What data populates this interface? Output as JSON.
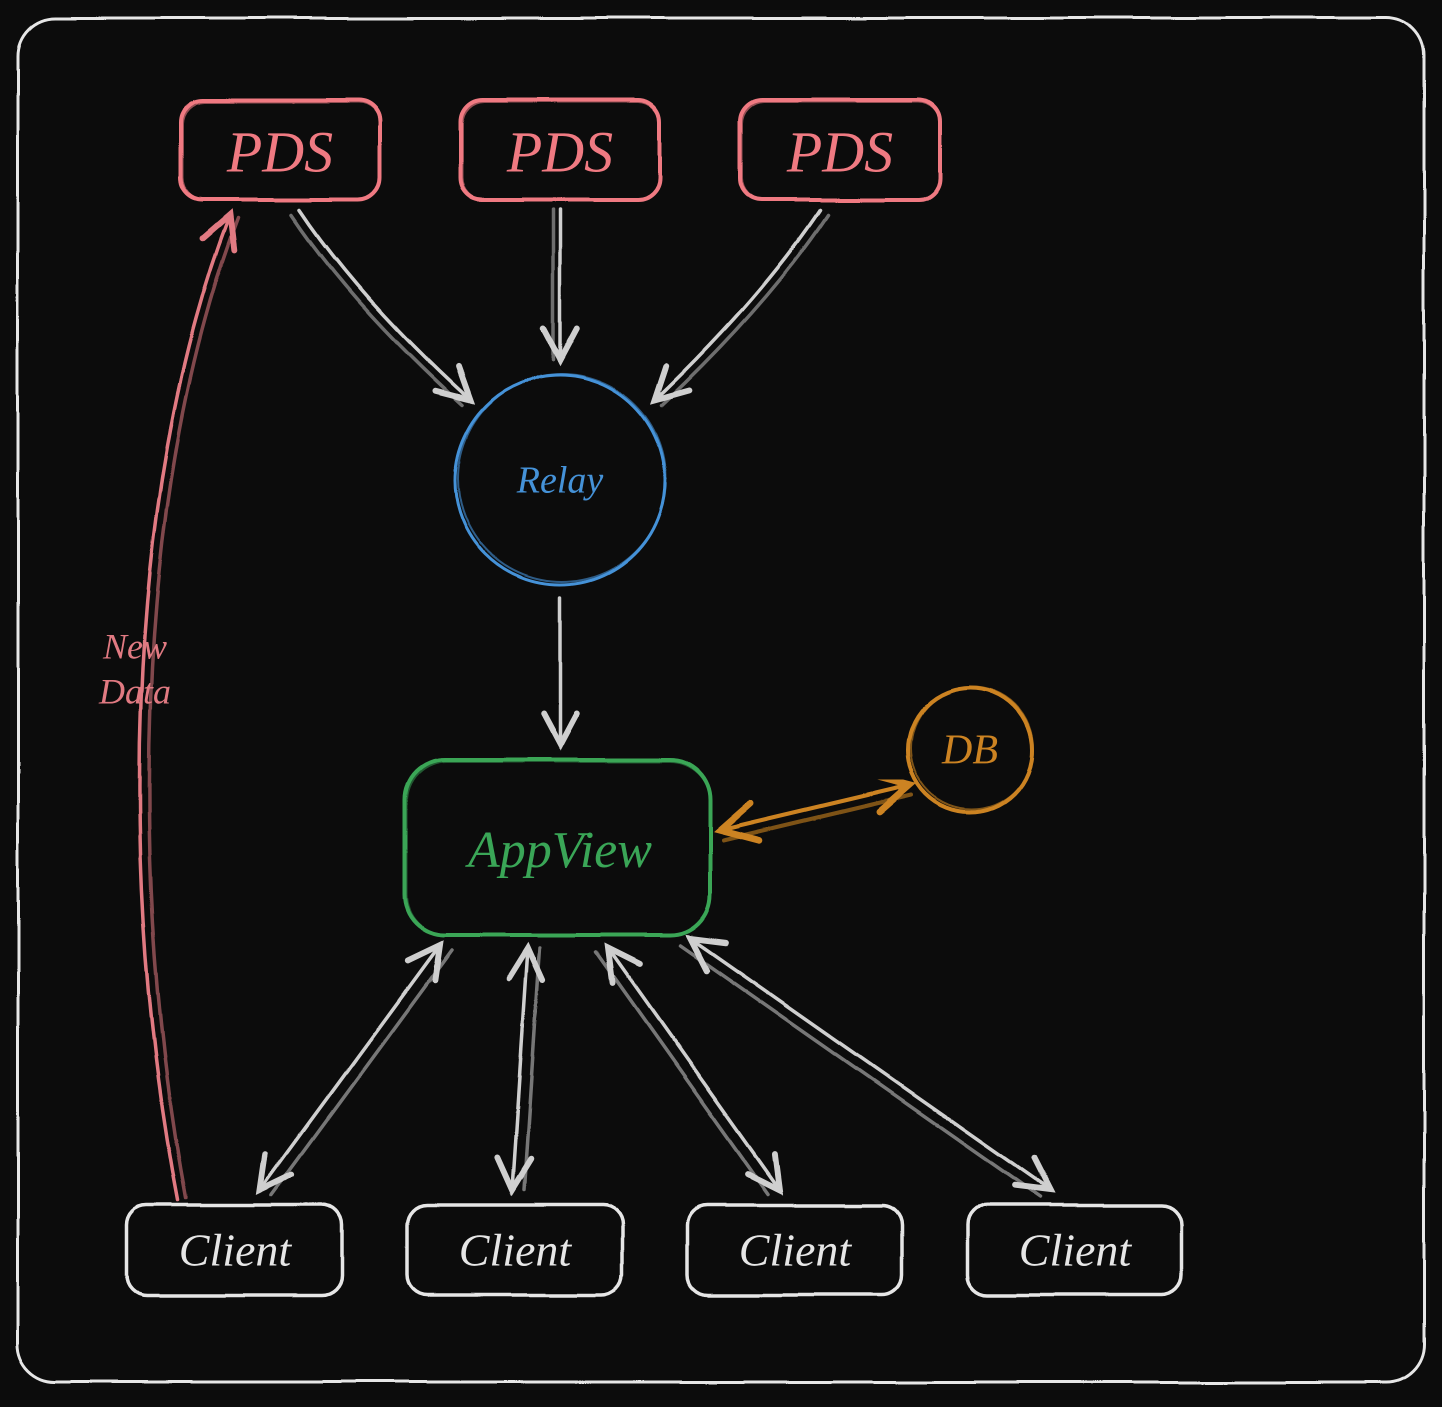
{
  "nodes": {
    "pds1": "PDS",
    "pds2": "PDS",
    "pds3": "PDS",
    "relay": "Relay",
    "appview": "AppView",
    "db": "DB",
    "client1": "Client",
    "client2": "Client",
    "client3": "Client",
    "client4": "Client"
  },
  "edgeLabel": {
    "line1": "New",
    "line2": "Data"
  },
  "colors": {
    "pds": "#f07a82",
    "relay": "#4592d8",
    "appview": "#3aa657",
    "db": "#cc8322",
    "client": "#e6e6e6",
    "arrow": "#cfcfcf",
    "frame": "#e6e6e6",
    "bg": "#0c0c0c"
  }
}
